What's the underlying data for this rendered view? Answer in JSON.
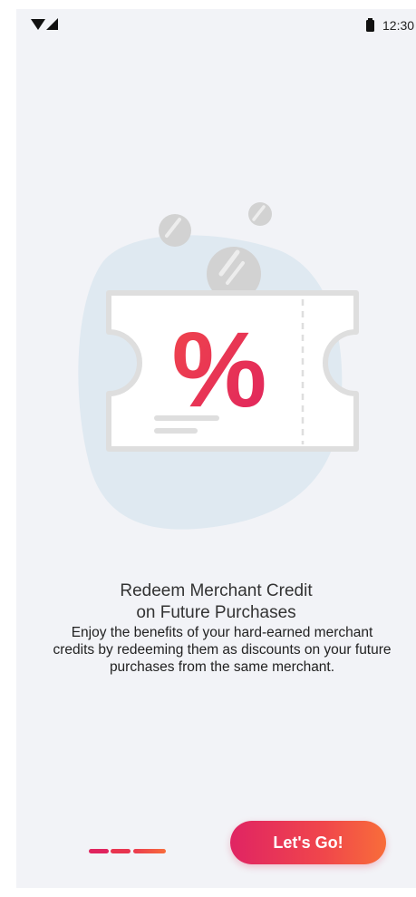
{
  "status_bar": {
    "time": "12:30",
    "icons": [
      "wifi-icon",
      "signal-icon",
      "battery-icon"
    ]
  },
  "illustration": {
    "icon": "discount-coupon-icon",
    "symbol": "%"
  },
  "content": {
    "title_line_1": "Redeem Merchant Credit",
    "title_line_2": "on Future Purchases",
    "description": "Enjoy the benefits of your hard-earned merchant credits by redeeming them as discounts on your future purchases from the same merchant."
  },
  "pager": {
    "total_pages": 3,
    "current_page": 3
  },
  "cta": {
    "label": "Let's Go!"
  },
  "colors": {
    "background": "#f2f3f7",
    "accent_start": "#e02463",
    "accent_end": "#f86d3a",
    "coupon_border": "#dedede",
    "blob": "#dfe9f1"
  }
}
